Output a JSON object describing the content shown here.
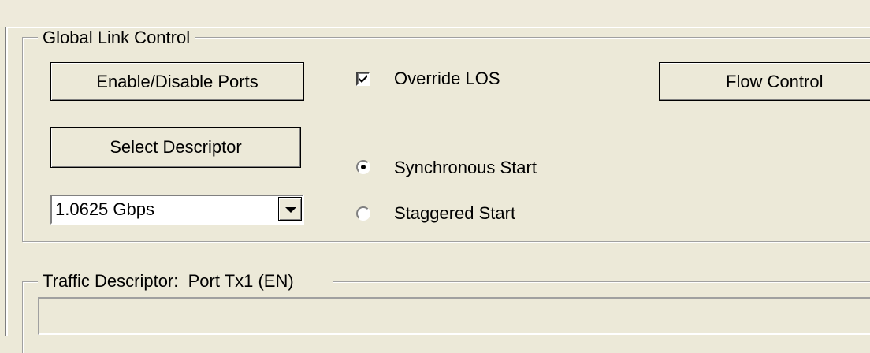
{
  "global_link_control": {
    "title": "Global Link Control",
    "enable_disable_ports_label": "Enable/Disable Ports",
    "select_descriptor_label": "Select Descriptor",
    "flow_control_label": "Flow Control",
    "override_los": {
      "label": "Override LOS",
      "checked": true
    },
    "start_mode": {
      "options": [
        "Synchronous Start",
        "Staggered Start"
      ],
      "selected": "Synchronous Start"
    },
    "speed_select": {
      "value": "1.0625 Gbps"
    }
  },
  "traffic_descriptor": {
    "title": "Traffic Descriptor:  Port Tx1 (EN)"
  },
  "icons": {
    "checkbox_check": "checkmark-icon",
    "combo_arrow": "chevron-down-icon"
  }
}
